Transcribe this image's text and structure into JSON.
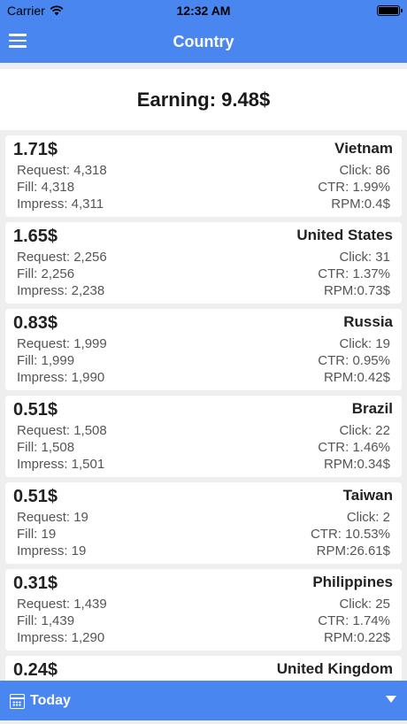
{
  "status": {
    "carrier": "Carrier",
    "time": "12:32 AM"
  },
  "nav": {
    "title": "Country"
  },
  "summary": {
    "earning": "Earning: 9.48$"
  },
  "countries": [
    {
      "amount": "1.71$",
      "name": "Vietnam",
      "request": "Request: 4,318",
      "fill": "Fill: 4,318",
      "impress": "Impress: 4,311",
      "click": "Click: 86",
      "ctr": "CTR: 1.99%",
      "rpm": "RPM:0.4$"
    },
    {
      "amount": "1.65$",
      "name": "United States",
      "request": "Request: 2,256",
      "fill": "Fill: 2,256",
      "impress": "Impress: 2,238",
      "click": "Click: 31",
      "ctr": "CTR: 1.37%",
      "rpm": "RPM:0.73$"
    },
    {
      "amount": "0.83$",
      "name": "Russia",
      "request": "Request: 1,999",
      "fill": "Fill: 1,999",
      "impress": "Impress: 1,990",
      "click": "Click: 19",
      "ctr": "CTR: 0.95%",
      "rpm": "RPM:0.42$"
    },
    {
      "amount": "0.51$",
      "name": "Brazil",
      "request": "Request: 1,508",
      "fill": "Fill: 1,508",
      "impress": "Impress: 1,501",
      "click": "Click: 22",
      "ctr": "CTR: 1.46%",
      "rpm": "RPM:0.34$"
    },
    {
      "amount": "0.51$",
      "name": "Taiwan",
      "request": "Request: 19",
      "fill": "Fill: 19",
      "impress": "Impress: 19",
      "click": "Click: 2",
      "ctr": "CTR: 10.53%",
      "rpm": "RPM:26.61$"
    },
    {
      "amount": "0.31$",
      "name": "Philippines",
      "request": "Request: 1,439",
      "fill": "Fill: 1,439",
      "impress": "Impress: 1,290",
      "click": "Click: 25",
      "ctr": "CTR: 1.74%",
      "rpm": "RPM:0.22$"
    },
    {
      "amount": "0.24$",
      "name": "United Kingdom"
    }
  ],
  "footer": {
    "period": "Today"
  }
}
